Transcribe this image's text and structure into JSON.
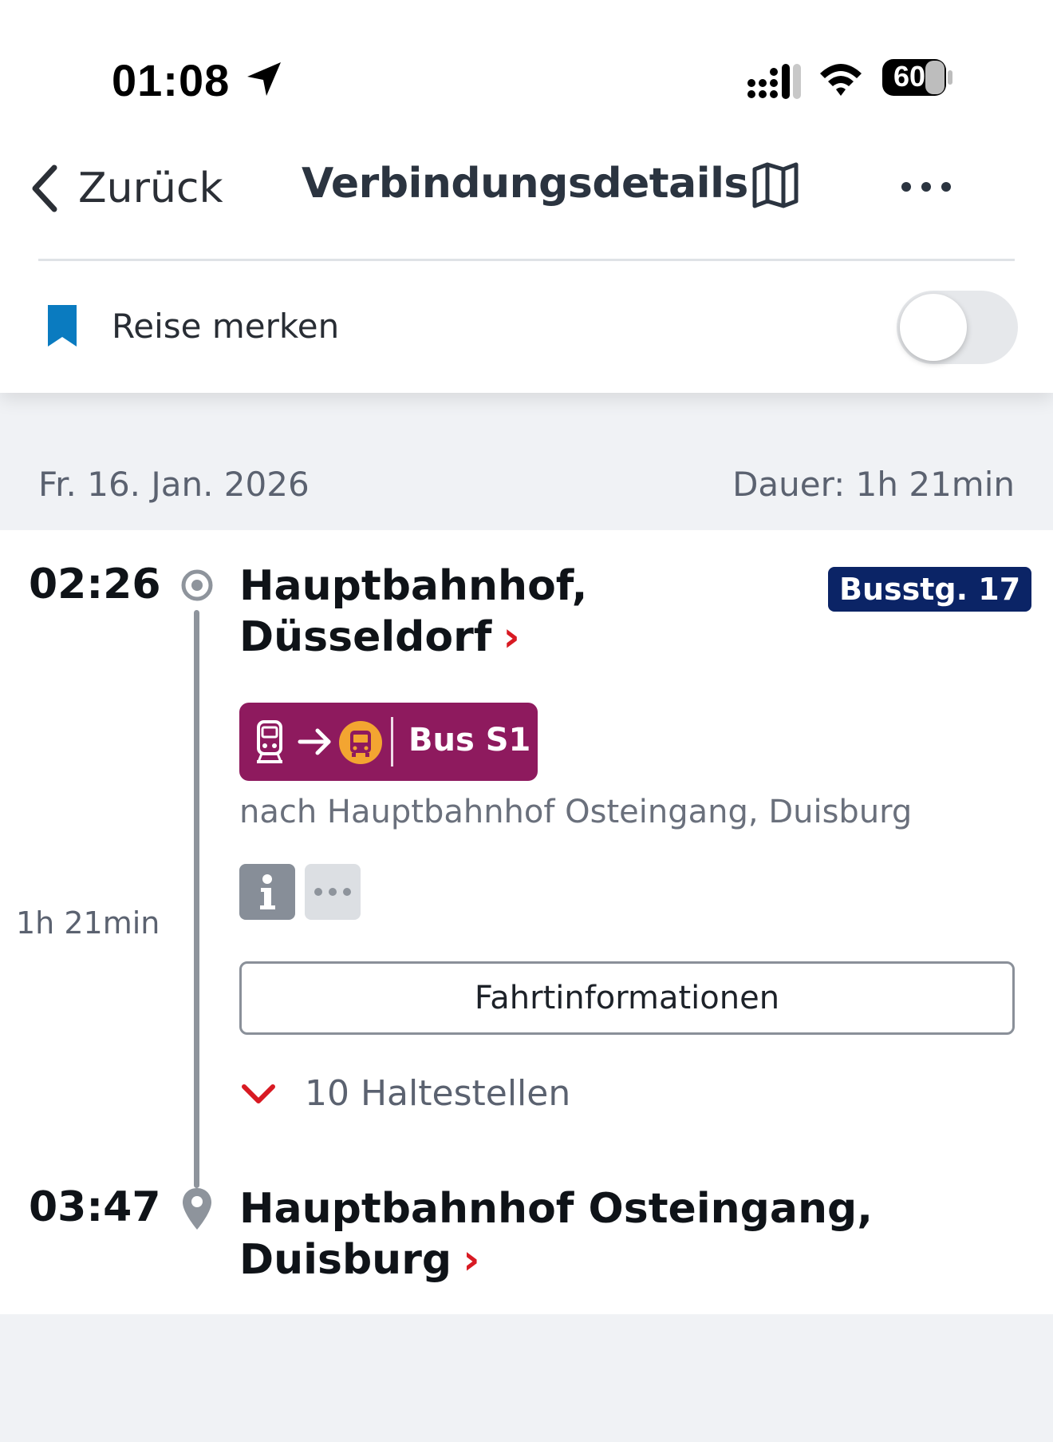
{
  "status_bar": {
    "time": "01:08",
    "battery": "60",
    "icons": [
      "location-arrow-icon",
      "cellular-signal-icon",
      "wifi-icon",
      "battery-icon"
    ]
  },
  "nav": {
    "back_label": "Zurück",
    "title": "Verbindungsdetails",
    "icons": [
      "chevron-left-icon",
      "map-icon",
      "more-horizontal-icon"
    ]
  },
  "bookmark": {
    "label": "Reise merken",
    "toggle_on": false,
    "icon_color": "#0a7bc0"
  },
  "trip": {
    "date": "Fr. 16. Jan. 2026",
    "duration": "Dauer: 1h 21min"
  },
  "leg": {
    "departure_time": "02:26",
    "departure_station_line1": "Hauptbahnhof,",
    "departure_station_line2": "Düsseldorf",
    "platform": "Busstg. 17",
    "line_label": "Bus S1",
    "line_color": "#8e1a5e",
    "platform_color": "#0b2466",
    "direction": "nach Hauptbahnhof Osteingang, Duisburg",
    "leg_duration": "1h 21min",
    "fahrt_button": "Fahrtinformationen",
    "stops_label": "10 Haltestellen",
    "arrival_time": "03:47",
    "arrival_station_line1": "Hauptbahnhof Osteingang,",
    "arrival_station_line2": "Duisburg",
    "chevron": "›"
  },
  "colors": {
    "accent_red": "#d81a23",
    "background": "#f0f2f5"
  }
}
